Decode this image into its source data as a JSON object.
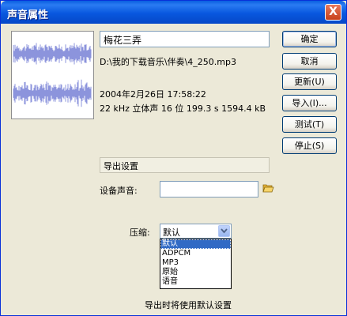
{
  "window": {
    "title": "声音属性",
    "close_label": "X"
  },
  "sound": {
    "name": "梅花三弄",
    "path": "D:\\我的下载音乐\\伴奏\\4_250.mp3",
    "date": "2004年2月26日  17:58:22",
    "info": "22 kHz 立体声 16 位 199.3 s 1594.4 kB"
  },
  "buttons": {
    "ok": "确定",
    "cancel": "取消",
    "update": "更新(U)",
    "import": "导入(I)...",
    "test": "测试(T)",
    "stop": "停止(S)"
  },
  "export": {
    "section_title": "导出设置",
    "device_label": "设备声音:",
    "device_value": "",
    "compression_label": "压缩:",
    "compression_value": "默认",
    "compression_options": [
      "默认",
      "ADPCM",
      "MP3",
      "原始",
      "语音"
    ],
    "selected_option": "默认",
    "status": "导出时将使用默认设置"
  },
  "colors": {
    "titlebar": "#0A5FE0",
    "waveform": "#8C94DC",
    "selection": "#316AC5"
  }
}
